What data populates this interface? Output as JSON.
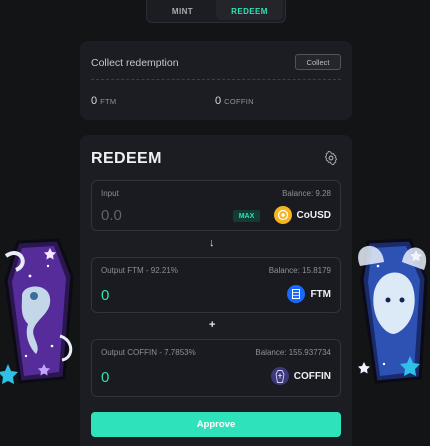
{
  "tabs": [
    {
      "label": "MINT",
      "active": false
    },
    {
      "label": "REDEEM",
      "active": true
    }
  ],
  "collect": {
    "title": "Collect redemption",
    "button": "Collect",
    "ftm_amount": "0",
    "ftm_unit": "FTM",
    "coffin_amount": "0",
    "coffin_unit": "COFFIN"
  },
  "redeem": {
    "title": "REDEEM",
    "input": {
      "label": "Input",
      "balance": "Balance: 9.28",
      "value": "0.0",
      "max_label": "MAX",
      "token": "CoUSD"
    },
    "arrow": "↓",
    "output_ftm": {
      "label": "Output FTM - 92.21%",
      "balance": "Balance: 15.8179",
      "value": "0",
      "token": "FTM"
    },
    "plus": "+",
    "output_coffin": {
      "label": "Output COFFIN - 7.7853%",
      "balance": "Balance: 155.937734",
      "value": "0",
      "token": "COFFIN"
    },
    "approve_label": "Approve"
  },
  "icons": {
    "settings": "gear-icon",
    "cousd": "cousd-token-icon",
    "ftm": "ftm-token-icon",
    "coffin": "coffin-token-icon"
  },
  "colors": {
    "accent": "#2ee3bc",
    "output_value": "#2fe0b6",
    "input_placeholder": "#5f636b"
  }
}
